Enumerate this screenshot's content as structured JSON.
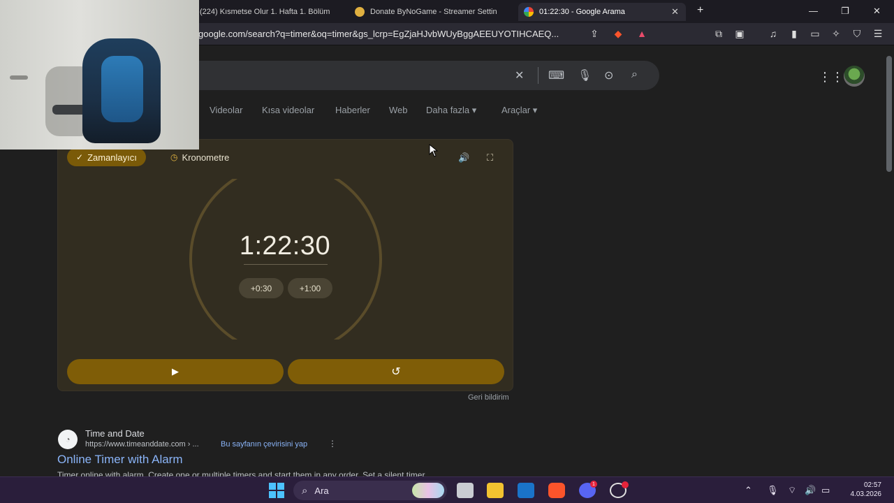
{
  "browser": {
    "tabs": [
      {
        "label": "(224) Kısmetse Olur 1. Hafta 1. Bölüm",
        "active": false
      },
      {
        "label": "Donate ByNoGame - Streamer Settin",
        "active": false
      },
      {
        "label": "01:22:30 - Google Arama",
        "active": true
      }
    ],
    "new_tab": "+",
    "close_tab": "✕",
    "window_controls": {
      "minimize": "—",
      "maximize": "❐",
      "close": "✕"
    },
    "url": "google.com/search?q=timer&oq=timer&gs_lcrp=EgZjaHJvbWUyBggAEEUYOTIHCAEQ..."
  },
  "google": {
    "search_tabs": [
      "Videolar",
      "Kısa videolar",
      "Haberler",
      "Web",
      "Daha fazla ▾",
      "Araçlar ▾"
    ]
  },
  "timer": {
    "mode_timer": "Zamanlayıcı",
    "mode_stopwatch": "Kronometre",
    "time": "1:22:30",
    "add_30": "+0:30",
    "add_100": "+1:00",
    "progress": 0.08,
    "accent_color": "#f2b43a",
    "ring_color": "#5a4c2a",
    "play_icon": "▶",
    "reset_icon": "↺"
  },
  "feedback": "Geri bildirim",
  "result": {
    "site_name": "Time and Date",
    "url": "https://www.timeanddate.com › ...",
    "translate": "Bu sayfanın çevirisini yap",
    "more": "⋮",
    "title": "Online Timer with Alarm",
    "snippet": "Timer online with alarm. Create one or multiple timers and start them in any order. Set a silent timer"
  },
  "taskbar": {
    "search_label": "Ara",
    "time": "02:57",
    "date": "4.03.2026",
    "discord_badge": "1"
  }
}
